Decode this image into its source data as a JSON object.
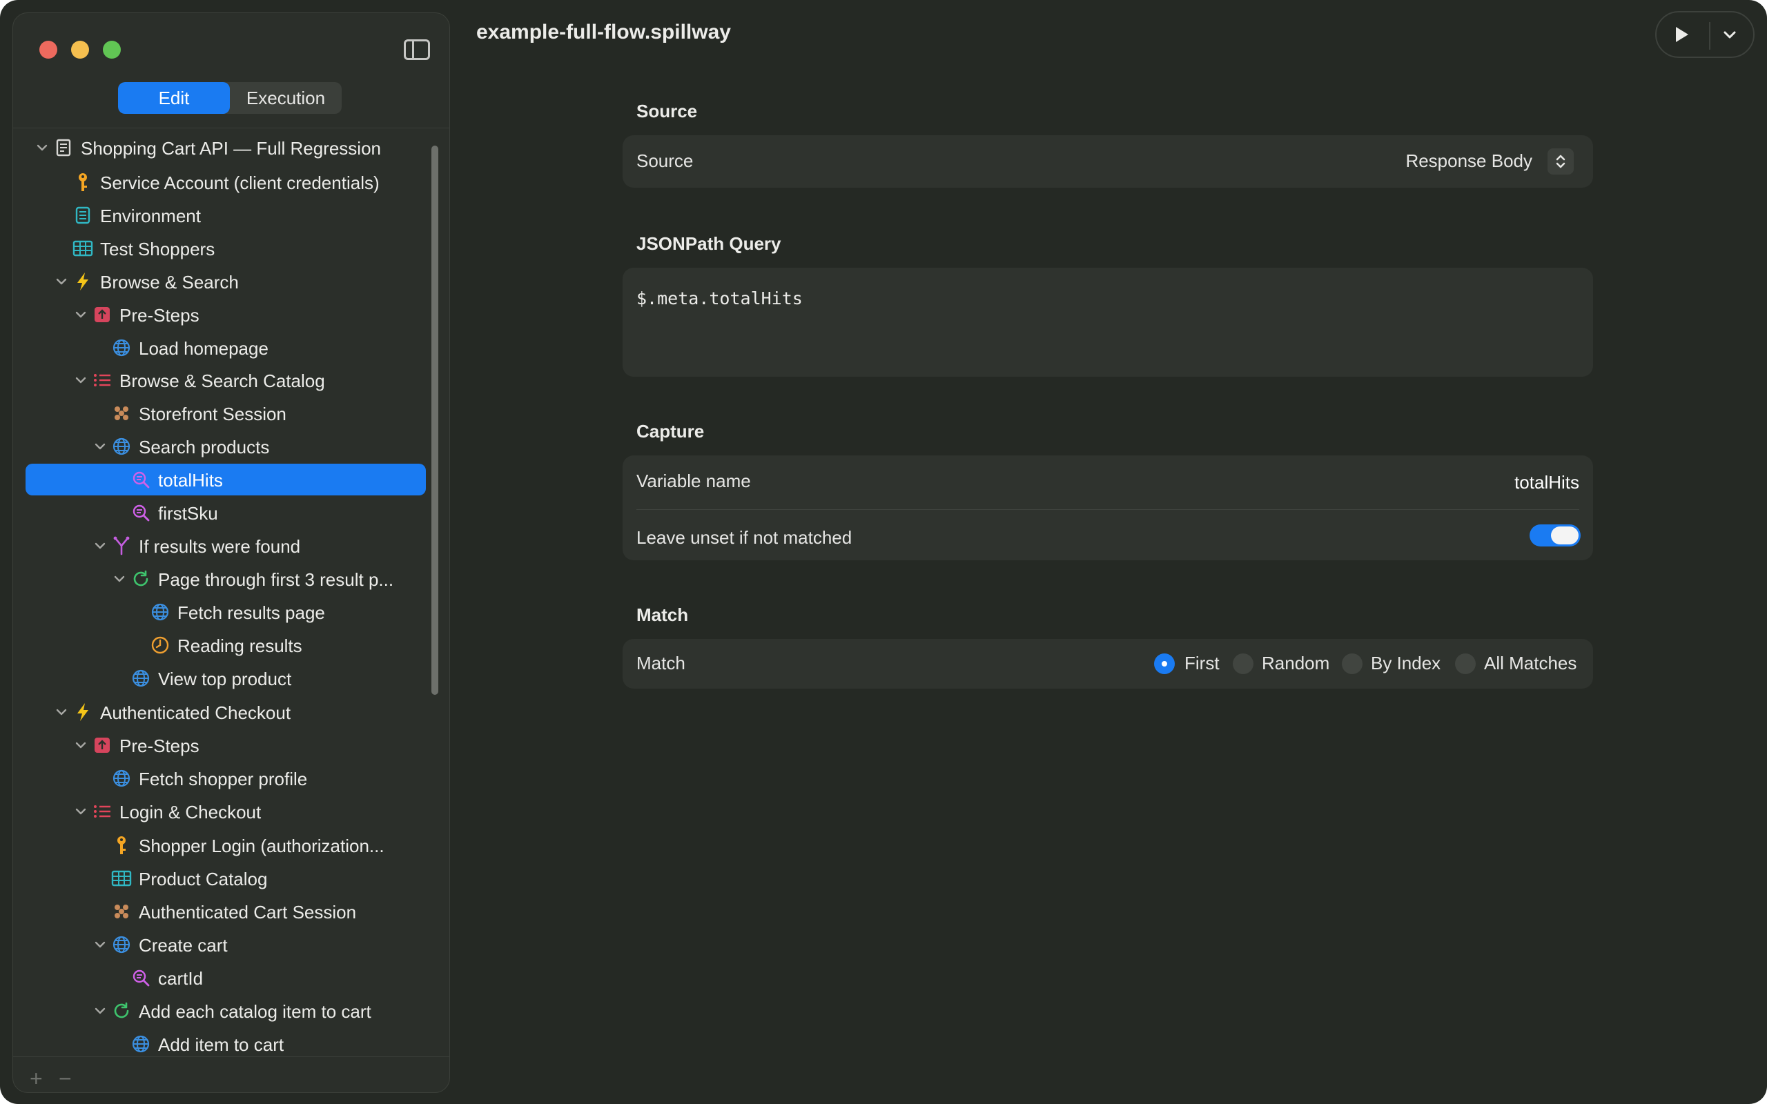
{
  "document_title": "example-full-flow.spillway",
  "sidebar": {
    "mode_tabs": [
      {
        "label": "Edit",
        "active": true
      },
      {
        "label": "Execution",
        "active": false
      }
    ],
    "tree": [
      {
        "label": "Shopping Cart API — Full Regression",
        "level": 0,
        "chevron": true,
        "icon": "document-icon"
      },
      {
        "label": "Service Account (client credentials)",
        "level": 1,
        "chevron": false,
        "icon": "key-icon"
      },
      {
        "label": "Environment",
        "level": 1,
        "chevron": false,
        "icon": "notebook-icon"
      },
      {
        "label": "Test Shoppers",
        "level": 1,
        "chevron": false,
        "icon": "table-icon"
      },
      {
        "label": "Browse & Search",
        "level": 1,
        "chevron": true,
        "icon": "bolt-icon"
      },
      {
        "label": "Pre-Steps",
        "level": 2,
        "chevron": true,
        "icon": "upload-icon"
      },
      {
        "label": "Load homepage",
        "level": 3,
        "chevron": false,
        "icon": "globe-icon"
      },
      {
        "label": "Browse & Search Catalog",
        "level": 2,
        "chevron": true,
        "icon": "list-icon"
      },
      {
        "label": "Storefront Session",
        "level": 3,
        "chevron": false,
        "icon": "cookie-icon"
      },
      {
        "label": "Search products",
        "level": 3,
        "chevron": true,
        "icon": "globe-icon"
      },
      {
        "label": "totalHits",
        "level": 4,
        "chevron": false,
        "icon": "extract-icon",
        "selected": true
      },
      {
        "label": "firstSku",
        "level": 4,
        "chevron": false,
        "icon": "extract-icon"
      },
      {
        "label": "If results were found",
        "level": 3,
        "chevron": true,
        "icon": "branch-icon"
      },
      {
        "label": "Page through first 3 result p...",
        "level": 4,
        "chevron": true,
        "icon": "loop-icon"
      },
      {
        "label": "Fetch results page",
        "level": 5,
        "chevron": false,
        "icon": "globe-icon"
      },
      {
        "label": "Reading results",
        "level": 5,
        "chevron": false,
        "icon": "clock-icon"
      },
      {
        "label": "View top product",
        "level": 4,
        "chevron": false,
        "icon": "globe-icon"
      },
      {
        "label": "Authenticated Checkout",
        "level": 1,
        "chevron": true,
        "icon": "bolt-icon"
      },
      {
        "label": "Pre-Steps",
        "level": 2,
        "chevron": true,
        "icon": "upload-icon"
      },
      {
        "label": "Fetch shopper profile",
        "level": 3,
        "chevron": false,
        "icon": "globe-icon"
      },
      {
        "label": "Login & Checkout",
        "level": 2,
        "chevron": true,
        "icon": "list-icon"
      },
      {
        "label": "Shopper Login (authorization...",
        "level": 3,
        "chevron": false,
        "icon": "key-icon"
      },
      {
        "label": "Product Catalog",
        "level": 3,
        "chevron": false,
        "icon": "table-icon"
      },
      {
        "label": "Authenticated Cart Session",
        "level": 3,
        "chevron": false,
        "icon": "cookie-icon"
      },
      {
        "label": "Create cart",
        "level": 3,
        "chevron": true,
        "icon": "globe-icon"
      },
      {
        "label": "cartId",
        "level": 4,
        "chevron": false,
        "icon": "extract-icon"
      },
      {
        "label": "Add each catalog item to cart",
        "level": 3,
        "chevron": true,
        "icon": "loop-icon"
      },
      {
        "label": "Add item to cart",
        "level": 4,
        "chevron": false,
        "icon": "globe-icon"
      }
    ],
    "add_label": "+",
    "remove_label": "−"
  },
  "editor": {
    "source_section": {
      "heading": "Source",
      "label": "Source",
      "value": "Response Body"
    },
    "query_section": {
      "heading": "JSONPath Query",
      "query": "$.meta.totalHits"
    },
    "capture_section": {
      "heading": "Capture",
      "variable_label": "Variable name",
      "variable_value": "totalHits",
      "leave_unset_label": "Leave unset if not matched",
      "leave_unset_on": true
    },
    "match_section": {
      "heading": "Match",
      "label": "Match",
      "options": [
        {
          "label": "First",
          "selected": true
        },
        {
          "label": "Random",
          "selected": false
        },
        {
          "label": "By Index",
          "selected": false
        },
        {
          "label": "All Matches",
          "selected": false
        }
      ]
    }
  },
  "colors": {
    "accent": "#1a7bf2",
    "window_bg": "#252924",
    "sidebar_bg": "#2b2f2a",
    "card_bg": "#2f332e",
    "icon_key": "#f5a623",
    "icon_globe": "#3b8fe0",
    "icon_table": "#30b8c4",
    "icon_bolt": "#f5c518",
    "icon_upload": "#d6455d",
    "icon_list": "#e2455a",
    "icon_cookie": "#c98b5a",
    "icon_extract": "#d061e8",
    "icon_branch": "#c55ee0",
    "icon_loop": "#3ec46d",
    "icon_clock": "#f0a030"
  }
}
